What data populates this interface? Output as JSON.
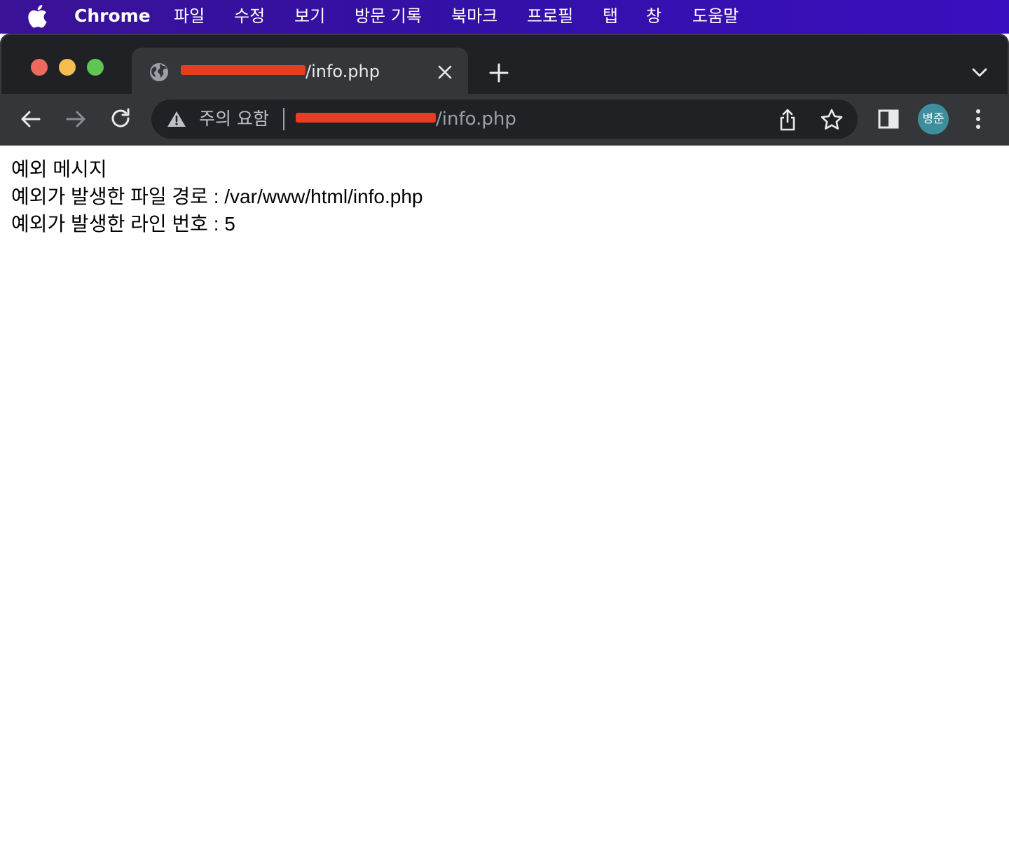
{
  "menubar": {
    "app_name": "Chrome",
    "items": [
      "파일",
      "수정",
      "보기",
      "방문 기록",
      "북마크",
      "프로필",
      "탭",
      "창",
      "도움말"
    ]
  },
  "tab": {
    "title_visible": "/info.php",
    "favicon": "globe-icon"
  },
  "omnibox": {
    "security_label": "주의 요함",
    "url_visible": "/info.php"
  },
  "profile": {
    "avatar_label": "병준",
    "avatar_color": "#3e8e9e"
  },
  "colors": {
    "menubar": "#3a10a6",
    "tabstrip": "#202124",
    "toolbar": "#35363a",
    "redaction": "#ea3b25"
  },
  "content": {
    "lines": [
      "예외 메시지",
      "예외가 발생한 파일 경로 : /var/www/html/info.php",
      "예외가 발생한 라인 번호 : 5"
    ]
  }
}
